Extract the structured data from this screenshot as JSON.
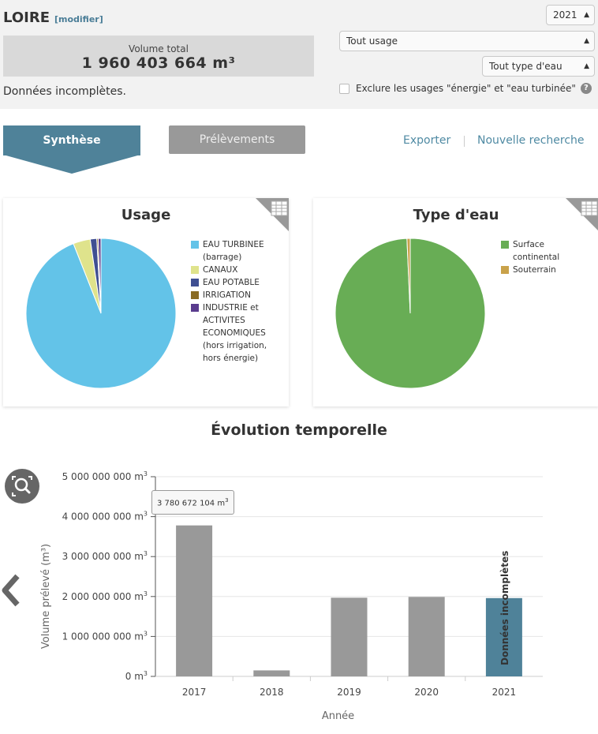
{
  "header": {
    "region": "LOIRE",
    "edit_link": "[modifier]",
    "volume_label": "Volume total",
    "volume_value": "1 960 403 664 m³",
    "incomplete_note": "Données incomplètes.",
    "year_select": "2021",
    "usage_select": "Tout usage",
    "water_type_select": "Tout type d'eau",
    "exclude_label": "Exclure les usages \"énergie\" et \"eau turbinée\"",
    "help_icon": "?"
  },
  "tabs": {
    "synthese": "Synthèse",
    "prelevements": "Prélèvements"
  },
  "links": {
    "export": "Exporter",
    "new_search": "Nouvelle recherche"
  },
  "pie_usage": {
    "title": "Usage",
    "colors": {
      "eau_turbinee": "#63c3e8",
      "canaux": "#dfe38c",
      "eau_potable": "#3f4f92",
      "irrigation": "#8a6b24",
      "industrie": "#5a3c8e"
    },
    "legend": [
      {
        "label_lines": [
          "EAU TURBINEE",
          "(barrage)"
        ],
        "color": "#63c3e8"
      },
      {
        "label_lines": [
          "CANAUX"
        ],
        "color": "#dfe38c"
      },
      {
        "label_lines": [
          "EAU POTABLE"
        ],
        "color": "#3f4f92"
      },
      {
        "label_lines": [
          "IRRIGATION"
        ],
        "color": "#8a6b24"
      },
      {
        "label_lines": [
          "INDUSTRIE et",
          "ACTIVITES",
          "ECONOMIQUES",
          "(hors irrigation,",
          "hors énergie)"
        ],
        "color": "#5a3c8e"
      }
    ]
  },
  "pie_water": {
    "title": "Type d'eau",
    "legend": [
      {
        "label_lines": [
          "Surface",
          "continental"
        ],
        "color": "#68ad55"
      },
      {
        "label_lines": [
          "Souterrain"
        ],
        "color": "#c9a24a"
      }
    ]
  },
  "evolution": {
    "title": "Évolution temporelle",
    "tooltip_value": "3 780 672 104 m",
    "tooltip_unit_sup": "3",
    "bar_label_2021": "Données incomplètes"
  },
  "chart_data": [
    {
      "type": "pie",
      "title": "Usage",
      "categories": [
        "EAU TURBINEE (barrage)",
        "CANAUX",
        "EAU POTABLE",
        "IRRIGATION",
        "INDUSTRIE et ACTIVITES ECONOMIQUES (hors irrigation, hors énergie)"
      ],
      "values": [
        94.0,
        3.7,
        1.4,
        0.3,
        0.6
      ]
    },
    {
      "type": "pie",
      "title": "Type d'eau",
      "categories": [
        "Surface continental",
        "Souterrain"
      ],
      "values": [
        99.3,
        0.7
      ]
    },
    {
      "type": "bar",
      "title": "Évolution temporelle",
      "categories": [
        "2017",
        "2018",
        "2019",
        "2020",
        "2021"
      ],
      "values": [
        3780672104,
        150000000,
        1970000000,
        1990000000,
        1960403664
      ],
      "colors": [
        "#999999",
        "#999999",
        "#999999",
        "#999999",
        "#4f8299"
      ],
      "xlabel": "Année",
      "ylabel": "Volume prélevé (m³)",
      "ylim": [
        0,
        5000000000
      ],
      "yticks": [
        0,
        1000000000,
        2000000000,
        3000000000,
        4000000000,
        5000000000
      ],
      "ytick_labels": [
        "0 m",
        "1 000 000 000 m",
        "2 000 000 000 m",
        "3 000 000 000 m",
        "4 000 000 000 m",
        "5 000 000 000 m"
      ],
      "ytick_sup": "3",
      "grid": true
    }
  ]
}
